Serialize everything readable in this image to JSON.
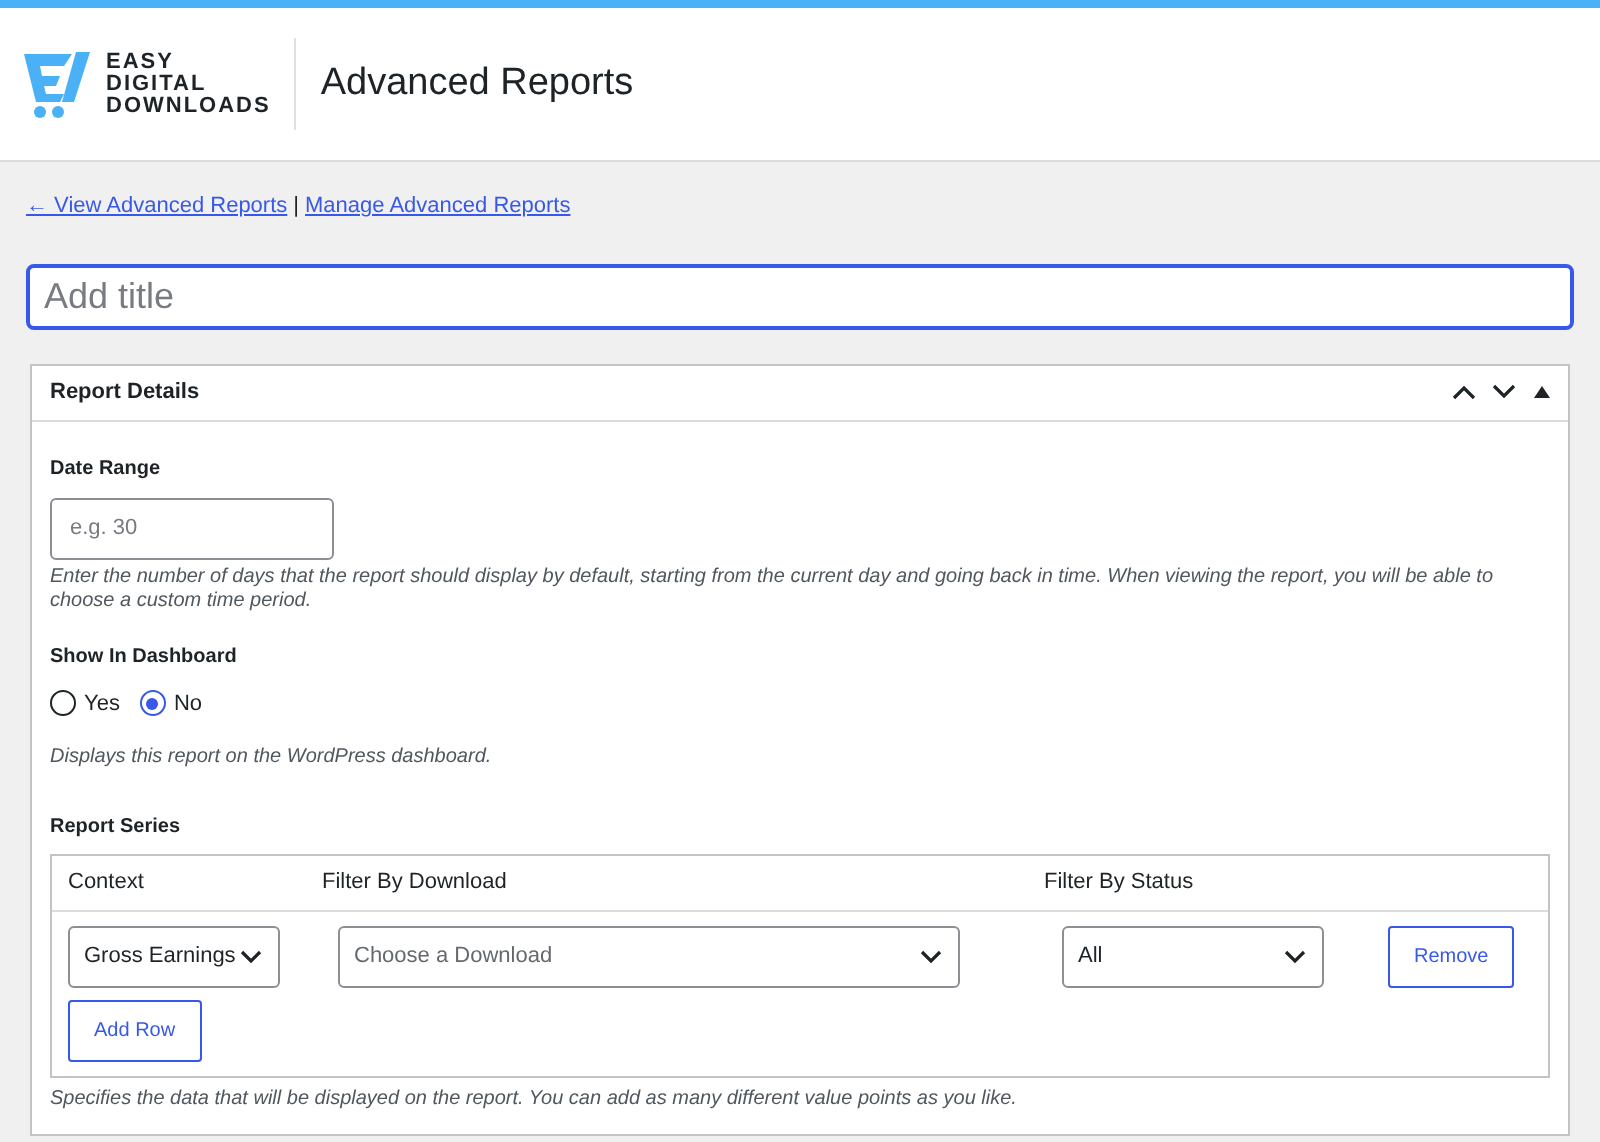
{
  "header": {
    "logo_lines": [
      "EASY",
      "DIGITAL",
      "DOWNLOADS"
    ],
    "title": "Advanced Reports"
  },
  "links": [
    {
      "label": "← View Advanced Reports"
    },
    {
      "label": "Manage Advanced Reports"
    }
  ],
  "link_separator": "|",
  "title_field": {
    "placeholder": "Add title"
  },
  "panel": {
    "title": "Report Details",
    "date_range": {
      "label": "Date Range",
      "placeholder": "e.g. 30",
      "help": "Enter the number of days that the report should display by default, starting from the current day and going back in time. When viewing the report, you will be able to choose a custom time period."
    },
    "show_in_dashboard": {
      "label": "Show In Dashboard",
      "options": [
        {
          "label": "Yes",
          "selected": false
        },
        {
          "label": "No",
          "selected": true
        }
      ],
      "help": "Displays this report on the WordPress dashboard."
    },
    "report_series": {
      "label": "Report Series",
      "columns": [
        "Context",
        "Filter By Download",
        "Filter By Status"
      ],
      "rows": [
        {
          "context": {
            "value": "Gross Earnings"
          },
          "download": {
            "placeholder": "Choose a Download"
          },
          "status": {
            "value": "All"
          },
          "remove": "Remove"
        }
      ],
      "add_row": "Add Row",
      "help": "Specifies the data that will be displayed on the report. You can add as many different value points as you like."
    }
  }
}
